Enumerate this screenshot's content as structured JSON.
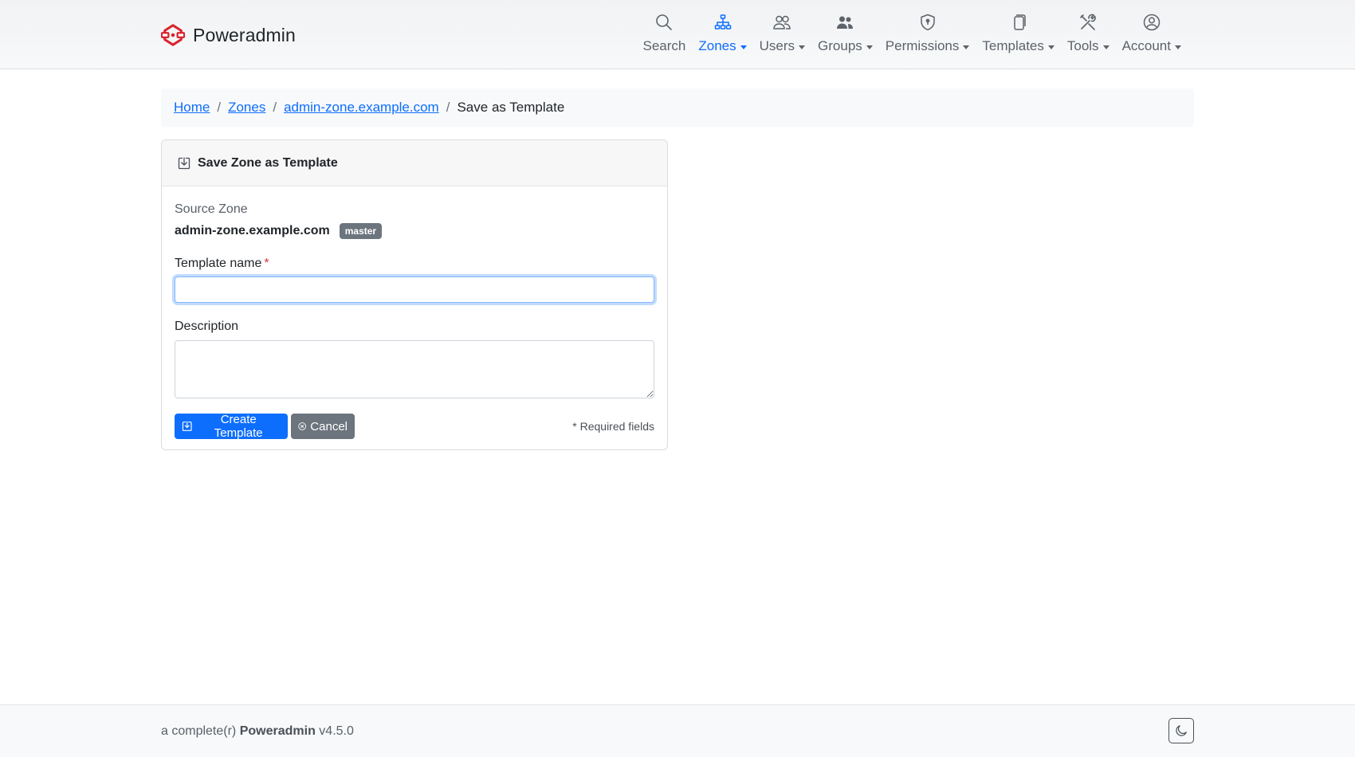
{
  "brand": {
    "name": "Poweradmin",
    "logo_color": "#d9232d"
  },
  "nav": {
    "active_color": "#0d6efd",
    "items": [
      {
        "label": "Search",
        "icon": "search-icon",
        "dropdown": false,
        "active": false
      },
      {
        "label": "Zones",
        "icon": "zones-hierarchy-icon",
        "dropdown": true,
        "active": true
      },
      {
        "label": "Users",
        "icon": "users-icon",
        "dropdown": true,
        "active": false
      },
      {
        "label": "Groups",
        "icon": "groups-icon",
        "dropdown": true,
        "active": false
      },
      {
        "label": "Permissions",
        "icon": "shield-icon",
        "dropdown": true,
        "active": false
      },
      {
        "label": "Templates",
        "icon": "copy-icon",
        "dropdown": true,
        "active": false
      },
      {
        "label": "Tools",
        "icon": "tools-icon",
        "dropdown": true,
        "active": false
      },
      {
        "label": "Account",
        "icon": "account-icon",
        "dropdown": true,
        "active": false
      }
    ]
  },
  "breadcrumb": {
    "items": [
      "Home",
      "Zones",
      "admin-zone.example.com"
    ],
    "current": "Save as Template"
  },
  "card": {
    "title": "Save Zone as Template",
    "title_icon": "save-download-icon",
    "source_label": "Source Zone",
    "source_zone": "admin-zone.example.com",
    "zone_type": "master",
    "template_name_label": "Template name",
    "required_mark": "*",
    "template_name_value": "",
    "description_label": "Description",
    "description_value": "",
    "create_button": "Create Template",
    "cancel_button": "Cancel",
    "required_note": "* Required fields"
  },
  "footer": {
    "prefix": "a complete(r)",
    "product": "Poweradmin",
    "version": "v4.5.0",
    "theme_toggle_icon": "moon-icon"
  }
}
